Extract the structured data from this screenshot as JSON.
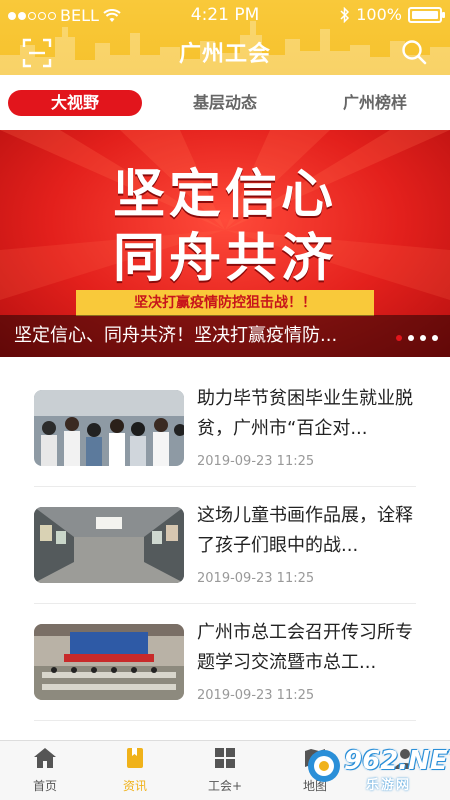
{
  "status_bar": {
    "carrier": "BELL",
    "time": "4:21 PM",
    "battery": "100%",
    "battery_level": 1.0
  },
  "header": {
    "title": "广州工会"
  },
  "tabs": [
    {
      "label": "大视野",
      "active": true
    },
    {
      "label": "基层动态",
      "active": false
    },
    {
      "label": "广州榜样",
      "active": false
    }
  ],
  "banner": {
    "line1": "坚定信心",
    "line2": "同舟共济",
    "strip": "坚决打赢疫情防控狙击战！！",
    "caption": "坚定信心、同舟共济！坚决打赢疫情防...",
    "slide_count": 4,
    "active_slide": 1
  },
  "news": [
    {
      "title": "助力毕节贫困毕业生就业脱贫，广州市“百企对...",
      "date": "2019-09-23  11:25"
    },
    {
      "title": "这场儿童书画作品展，诠释了孩子们眼中的战...",
      "date": "2019-09-23  11:25"
    },
    {
      "title": "广州市总工会召开传习所专题学习交流暨市总工...",
      "date": "2019-09-23  11:25"
    },
    {
      "title": "",
      "date": ""
    }
  ],
  "bottom_nav": [
    {
      "label": "首页",
      "icon": "home-icon",
      "active": false
    },
    {
      "label": "资讯",
      "icon": "bookmark-icon",
      "active": true
    },
    {
      "label": "工会+",
      "icon": "grid-icon",
      "active": false
    },
    {
      "label": "地图",
      "icon": "map-icon",
      "active": false
    },
    {
      "label": "",
      "icon": "user-icon",
      "active": false
    }
  ],
  "watermark": {
    "text": "962.NET",
    "sub": "乐游网"
  },
  "colors": {
    "header_yellow": "#f6c12c",
    "accent_red": "#e2151c",
    "active_nav": "#f0b21a"
  }
}
